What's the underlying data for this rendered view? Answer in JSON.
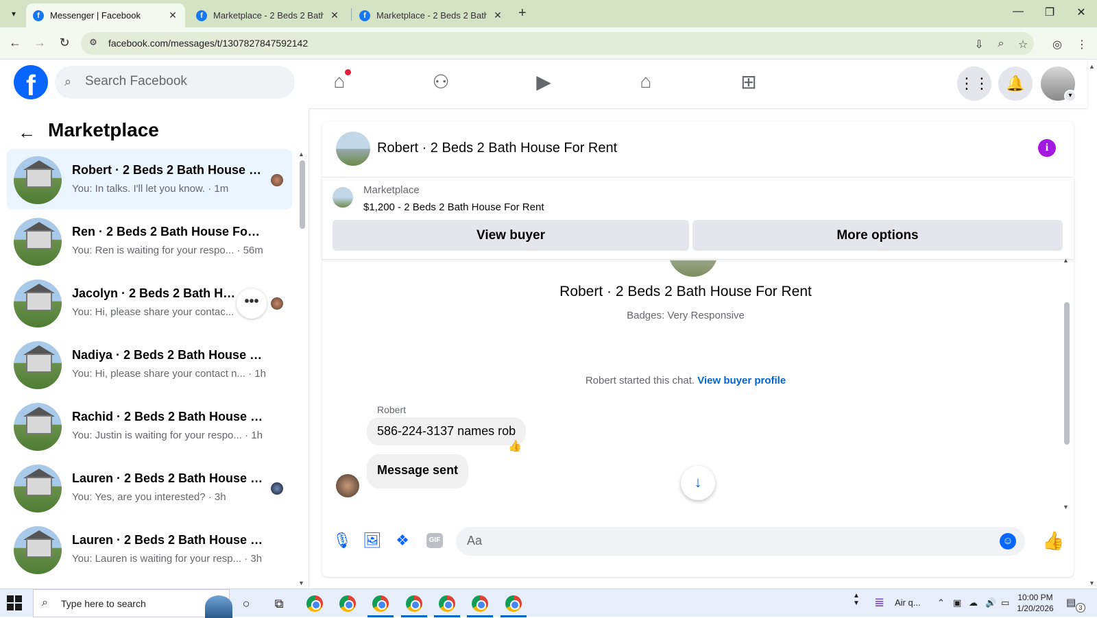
{
  "browser": {
    "tabs": [
      {
        "title": "Messenger | Facebook",
        "active": true
      },
      {
        "title": "Marketplace - 2 Beds 2 Bath Ho",
        "active": false
      },
      {
        "title": "Marketplace - 2 Beds 2 Bath Ho",
        "active": false
      }
    ],
    "url": "facebook.com/messages/t/1307827847592142"
  },
  "header": {
    "search_placeholder": "Search Facebook",
    "logo": "f"
  },
  "left_panel": {
    "title": "Marketplace",
    "conversations": [
      {
        "name": "Robert · 2 Beds 2 Bath House For Rent",
        "preview": "You: In talks. I'll let you know. · 1m",
        "active": true,
        "seen": "avatar"
      },
      {
        "name": "Ren · 2 Beds 2 Bath House For Rent",
        "preview": "You: Ren is waiting for your respo... · 56m",
        "active": false,
        "seen": "none"
      },
      {
        "name": "Jacolyn · 2 Beds 2 Bath House For Rent",
        "preview": "You: Hi, please share your contac...",
        "active": false,
        "seen": "avatar",
        "hover_more": "•••"
      },
      {
        "name": "Nadiya · 2 Beds 2 Bath House For Rent",
        "preview": "You: Hi, please share your contact n... · 1h",
        "active": false,
        "seen": "none"
      },
      {
        "name": "Rachid · 2 Beds 2 Bath House For Rent",
        "preview": "You: Justin is waiting for your respo... · 1h",
        "active": false,
        "seen": "none"
      },
      {
        "name": "Lauren · 2 Beds 2 Bath House For Rent",
        "preview": "You: Yes, are you interested? · 3h",
        "active": false,
        "seen": "dark"
      },
      {
        "name": "Lauren · 2 Beds 2 Bath House For Rent",
        "preview": "You: Lauren is waiting for your resp... · 3h",
        "active": false,
        "seen": "none"
      }
    ]
  },
  "chat": {
    "title": "Robert · 2 Beds 2 Bath House For Rent",
    "info_icon": "i",
    "marketplace_label": "Marketplace",
    "listing": "$1,200 - 2 Beds 2 Bath House For Rent",
    "view_buyer_label": "View buyer",
    "more_options_label": "More options",
    "profile_title": "Robert · 2 Beds 2 Bath House For Rent",
    "badges": "Badges: Very Responsive",
    "started_text": "Robert started this chat.",
    "view_profile_link": "View buyer profile",
    "sender": "Robert",
    "messages": [
      {
        "text": "586-224-3137 names rob",
        "reaction": "thumbs-up"
      },
      {
        "text": "Message sent"
      }
    ],
    "composer_placeholder": "Aa",
    "gif_label": "GIF"
  },
  "taskbar": {
    "search_text": "Type here to search",
    "weather": "Air q...",
    "time": "10:00 PM",
    "date": "1/20/2026",
    "notification_count": "3"
  },
  "colors": {
    "fb_blue": "#0866ff",
    "active_conv_bg": "#ebf5ff",
    "info_purple": "#a319e0",
    "chrome_frame": "#d3e3c4"
  }
}
